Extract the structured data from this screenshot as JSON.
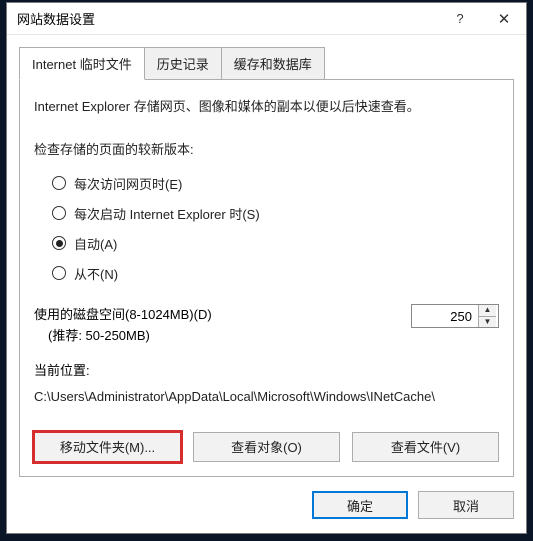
{
  "window": {
    "title": "网站数据设置",
    "help_icon": "?",
    "close_icon": "✕"
  },
  "tabs": [
    {
      "label": "Internet 临时文件",
      "active": true
    },
    {
      "label": "历史记录",
      "active": false
    },
    {
      "label": "缓存和数据库",
      "active": false
    }
  ],
  "panel": {
    "description": "Internet Explorer 存储网页、图像和媒体的副本以便以后快速查看。",
    "version_check_label": "检查存储的页面的较新版本:",
    "radios": [
      {
        "label": "每次访问网页时(E)",
        "checked": false
      },
      {
        "label": "每次启动 Internet Explorer 时(S)",
        "checked": false
      },
      {
        "label": "自动(A)",
        "checked": true
      },
      {
        "label": "从不(N)",
        "checked": false
      }
    ],
    "disk": {
      "label": "使用的磁盘空间(8-1024MB)(D)",
      "hint": "(推荐: 50-250MB)",
      "value": "250"
    },
    "location": {
      "label": "当前位置:",
      "path": "C:\\Users\\Administrator\\AppData\\Local\\Microsoft\\Windows\\INetCache\\"
    },
    "buttons": {
      "move": "移动文件夹(M)...",
      "view_objects": "查看对象(O)",
      "view_files": "查看文件(V)"
    }
  },
  "footer": {
    "ok": "确定",
    "cancel": "取消"
  }
}
